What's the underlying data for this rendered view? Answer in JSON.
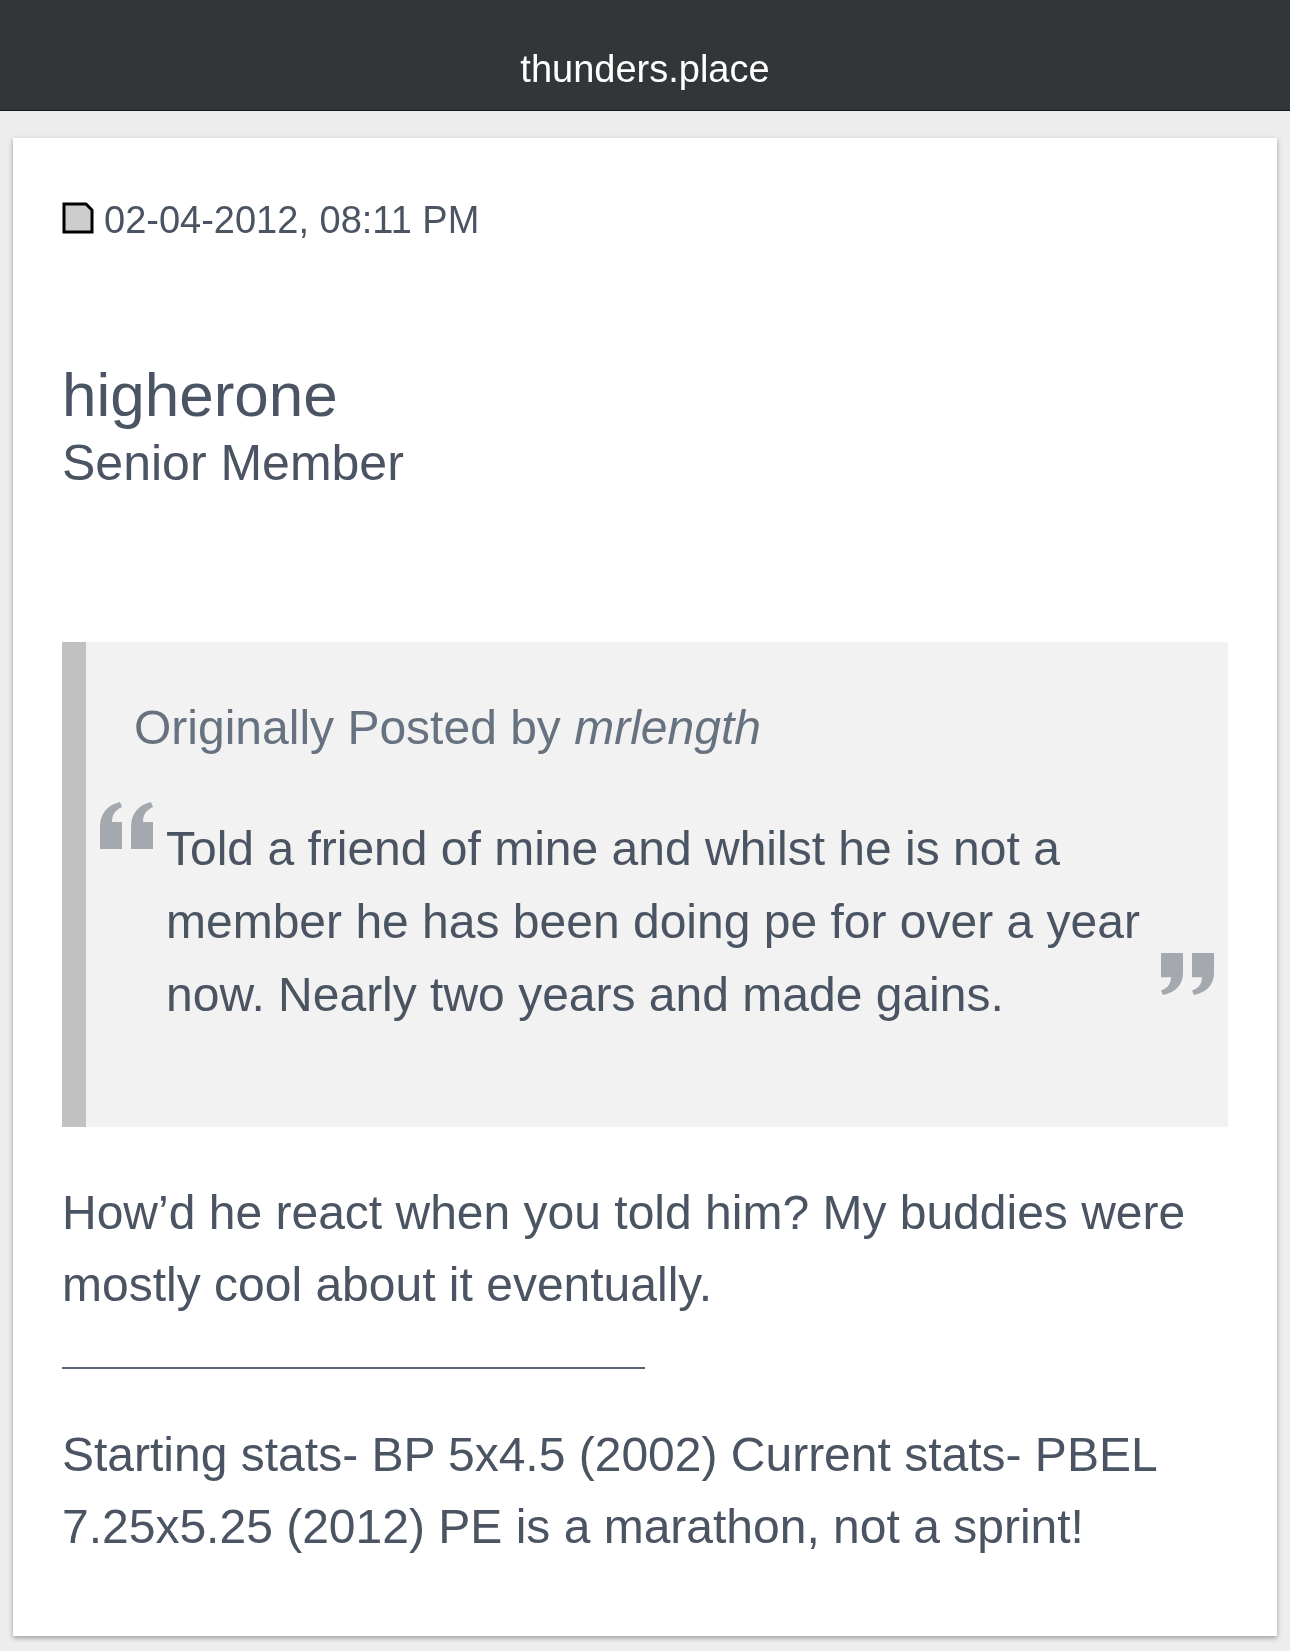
{
  "header": {
    "title": "thunders.place"
  },
  "post": {
    "date": "02-04-2012, 08:11 PM",
    "author": {
      "name": "higherone",
      "rank": "Senior Member"
    },
    "quote": {
      "attribution": "Originally Posted by *mrlength*",
      "text": "Told a friend of mine and whilst he is not a member he has been doing pe for over a year now. Nearly two years and made gains."
    },
    "message": "How’d he react when you told him? My buddies were mostly cool about it eventually.",
    "signature": "Starting stats- BP 5x4.5 (2002) Current stats- PBEL 7.25x5.25 (2012) PE is a marathon, not a sprint!"
  }
}
